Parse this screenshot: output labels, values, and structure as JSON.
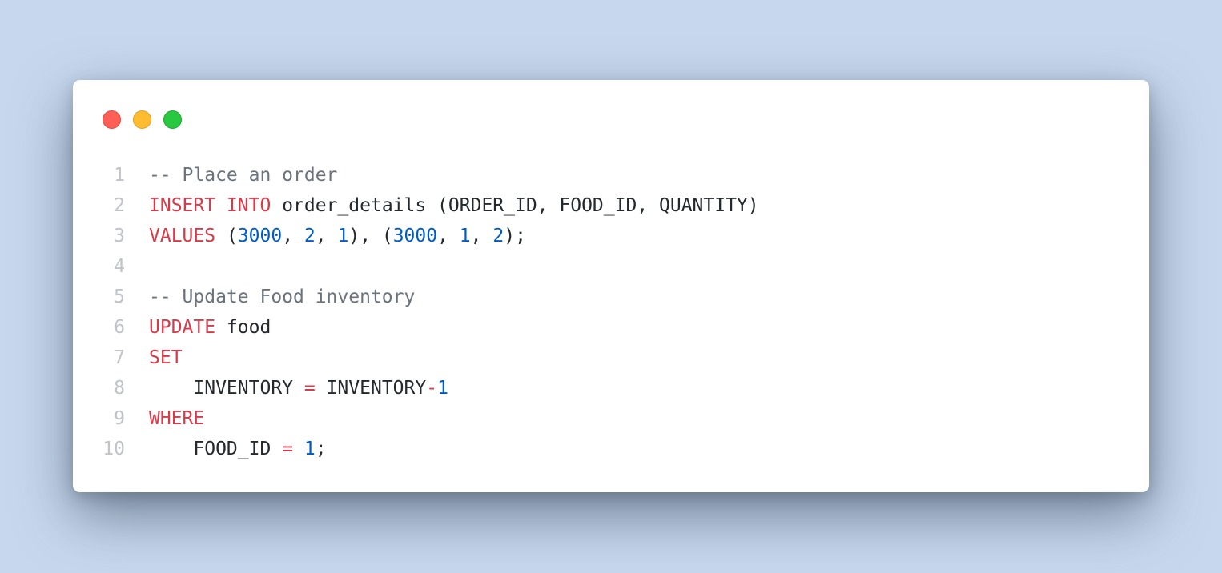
{
  "window": {
    "controls": [
      "close",
      "minimize",
      "zoom"
    ]
  },
  "code": {
    "language": "sql",
    "lines": [
      {
        "number": "1",
        "tokens": [
          {
            "t": "-- Place an order",
            "k": "comment"
          }
        ]
      },
      {
        "number": "2",
        "tokens": [
          {
            "t": "INSERT",
            "k": "keyword"
          },
          {
            "t": " ",
            "k": "plain"
          },
          {
            "t": "INTO",
            "k": "keyword"
          },
          {
            "t": " order_details (ORDER_ID, FOOD_ID, QUANTITY)",
            "k": "plain"
          }
        ]
      },
      {
        "number": "3",
        "tokens": [
          {
            "t": "VALUES",
            "k": "keyword"
          },
          {
            "t": " (",
            "k": "plain"
          },
          {
            "t": "3000",
            "k": "number"
          },
          {
            "t": ", ",
            "k": "plain"
          },
          {
            "t": "2",
            "k": "number"
          },
          {
            "t": ", ",
            "k": "plain"
          },
          {
            "t": "1",
            "k": "number"
          },
          {
            "t": "), (",
            "k": "plain"
          },
          {
            "t": "3000",
            "k": "number"
          },
          {
            "t": ", ",
            "k": "plain"
          },
          {
            "t": "1",
            "k": "number"
          },
          {
            "t": ", ",
            "k": "plain"
          },
          {
            "t": "2",
            "k": "number"
          },
          {
            "t": ");",
            "k": "plain"
          }
        ]
      },
      {
        "number": "4",
        "tokens": []
      },
      {
        "number": "5",
        "tokens": [
          {
            "t": "-- Update Food inventory",
            "k": "comment"
          }
        ]
      },
      {
        "number": "6",
        "tokens": [
          {
            "t": "UPDATE",
            "k": "keyword"
          },
          {
            "t": " food",
            "k": "plain"
          }
        ]
      },
      {
        "number": "7",
        "tokens": [
          {
            "t": "SET",
            "k": "keyword"
          }
        ]
      },
      {
        "number": "8",
        "tokens": [
          {
            "t": "    INVENTORY ",
            "k": "plain"
          },
          {
            "t": "=",
            "k": "operator"
          },
          {
            "t": " INVENTORY",
            "k": "plain"
          },
          {
            "t": "-",
            "k": "operator"
          },
          {
            "t": "1",
            "k": "number"
          }
        ]
      },
      {
        "number": "9",
        "tokens": [
          {
            "t": "WHERE",
            "k": "keyword"
          }
        ]
      },
      {
        "number": "10",
        "tokens": [
          {
            "t": "    FOOD_ID ",
            "k": "plain"
          },
          {
            "t": "=",
            "k": "operator"
          },
          {
            "t": " ",
            "k": "plain"
          },
          {
            "t": "1",
            "k": "number"
          },
          {
            "t": ";",
            "k": "plain"
          }
        ]
      }
    ]
  }
}
